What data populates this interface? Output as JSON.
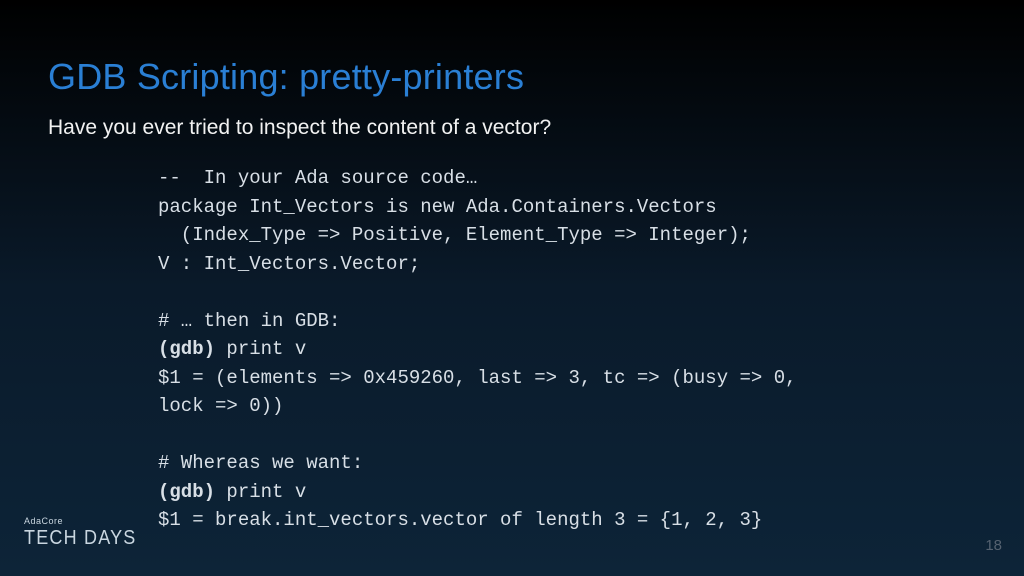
{
  "slide": {
    "title": "GDB Scripting: pretty-printers",
    "subtitle": "Have you ever tried to inspect the content of a vector?",
    "code": {
      "l1": "--  In your Ada source code…",
      "l2": "package Int_Vectors is new Ada.Containers.Vectors",
      "l3": "  (Index_Type => Positive, Element_Type => Integer);",
      "l4": "V : Int_Vectors.Vector;",
      "l5": "",
      "l6": "# … then in GDB:",
      "l7a": "(gdb)",
      "l7b": " print v",
      "l8": "$1 = (elements => 0x459260, last => 3, tc => (busy => 0,",
      "l9": "lock => 0))",
      "l10": "",
      "l11": "# Whereas we want:",
      "l12a": "(gdb)",
      "l12b": " print v",
      "l13": "$1 = break.int_vectors.vector of length 3 = {1, 2, 3}"
    }
  },
  "footer": {
    "logo_top": "AdaCore",
    "logo_bottom": "TECH DAYS",
    "page_number": "18"
  }
}
